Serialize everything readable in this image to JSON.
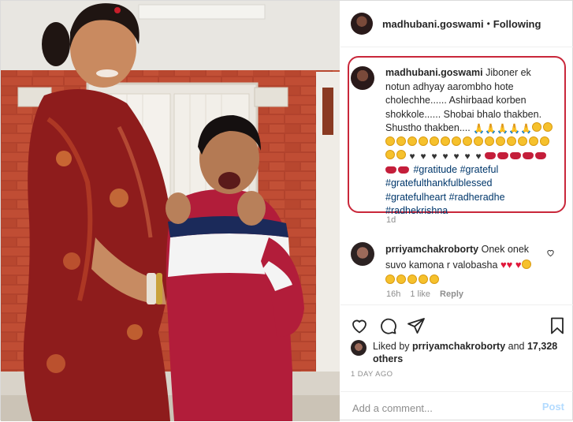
{
  "header": {
    "username": "madhubani.goswami",
    "separator": "•",
    "follow_status": "Following"
  },
  "caption": {
    "username": "madhubani.goswami",
    "text": "Jiboner ek notun adhyay aarombho hote cholechhe...... Ashirbaad korben shokkole...... Shobai bhalo thakben. Shustho thakben....",
    "hashtags": [
      "#gratitude",
      "#grateful",
      "#gratefulthankfulblessed",
      "#gratefulheart",
      "#radheradhe",
      "#radhekrishna"
    ],
    "time": "1d"
  },
  "comment": {
    "username": "prriyamchakroborty",
    "text": "Onek onek suvo kamona r valobasha",
    "time": "16h",
    "likes": "1 like",
    "reply": "Reply"
  },
  "likes": {
    "liked_by_prefix": "Liked by",
    "liked_by_user": "prriyamchakroborty",
    "and": "and",
    "others": "17,328 others"
  },
  "post_time": "1 DAY AGO",
  "add_comment": {
    "placeholder": "Add a comment...",
    "post_label": "Post"
  },
  "icons": {
    "like": "heart-icon",
    "comment": "comment-icon",
    "share": "send-icon",
    "save": "bookmark-icon"
  },
  "colors": {
    "highlight_border": "#c9273a",
    "hashtag": "#00376b",
    "post_button": "#b3dbff"
  }
}
